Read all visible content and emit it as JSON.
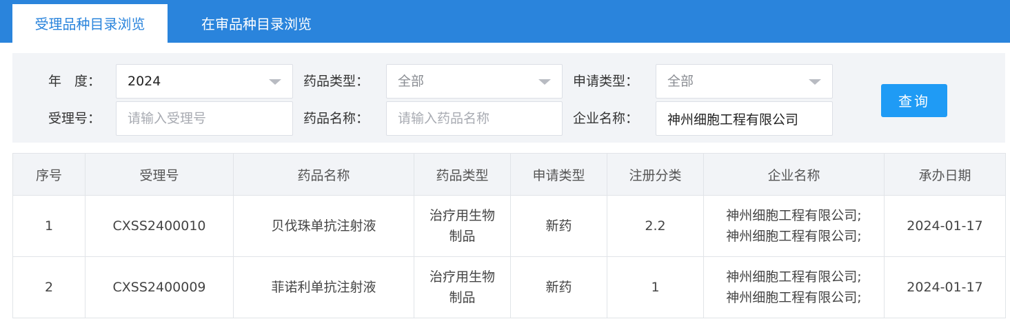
{
  "tabs": [
    {
      "label": "受理品种目录浏览",
      "active": true
    },
    {
      "label": "在审品种目录浏览",
      "active": false
    }
  ],
  "filters": {
    "year": {
      "label": "年　度：",
      "value": "2024"
    },
    "drug_type": {
      "label": "药品类型：",
      "value": "全部"
    },
    "apply_type": {
      "label": "申请类型：",
      "value": "全部"
    },
    "accept_no": {
      "label": "受理号：",
      "value": "",
      "placeholder": "请输入受理号"
    },
    "drug_name": {
      "label": "药品名称：",
      "value": "",
      "placeholder": "请输入药品名称"
    },
    "company": {
      "label": "企业名称：",
      "value": "神州细胞工程有限公司"
    },
    "query_label": "查询"
  },
  "table": {
    "headers": [
      "序号",
      "受理号",
      "药品名称",
      "药品类型",
      "申请类型",
      "注册分类",
      "企业名称",
      "承办日期"
    ],
    "rows": [
      {
        "no": "1",
        "accept_no": "CXSS2400010",
        "drug_name": "贝伐珠单抗注射液",
        "drug_type": "治疗用生物制品",
        "apply_type": "新药",
        "reg_class": "2.2",
        "company_line1": "神州细胞工程有限公司;",
        "company_line2": "神州细胞工程有限公司;",
        "date": "2024-01-17"
      },
      {
        "no": "2",
        "accept_no": "CXSS2400009",
        "drug_name": "菲诺利单抗注射液",
        "drug_type": "治疗用生物制品",
        "apply_type": "新药",
        "reg_class": "1",
        "company_line1": "神州细胞工程有限公司;",
        "company_line2": "神州细胞工程有限公司;",
        "date": "2024-01-17"
      }
    ]
  },
  "colors": {
    "accent": "#2a84dc",
    "button": "#1f9bf5"
  }
}
